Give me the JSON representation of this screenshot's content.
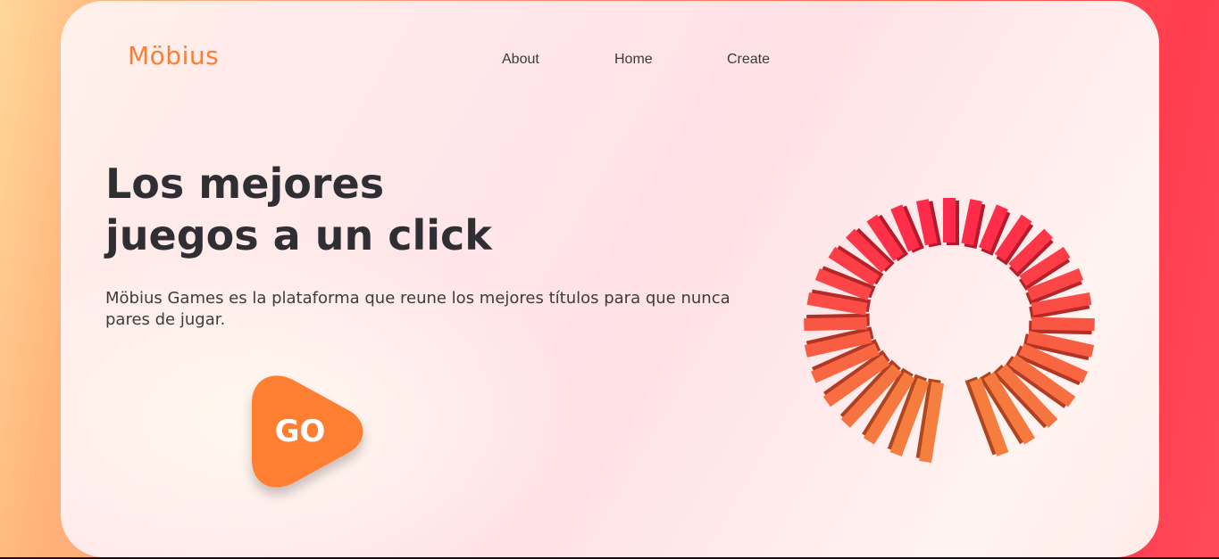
{
  "brand": {
    "logo": "Möbius",
    "color": "#f5803e"
  },
  "nav": {
    "items": [
      {
        "label": "About"
      },
      {
        "label": "Home"
      },
      {
        "label": "Create"
      }
    ]
  },
  "hero": {
    "title_line1": "Los mejores",
    "title_line2": "juegos a un click",
    "subtitle": "Möbius Games es la plataforma que reune los mejores títulos para que nunca pares de jugar."
  },
  "cta": {
    "label": "GO",
    "color": "#ff7f32"
  },
  "illustration": {
    "name": "domino-spiral",
    "colors": [
      "#f5803e",
      "#ff2a4a",
      "#e8423a"
    ]
  }
}
